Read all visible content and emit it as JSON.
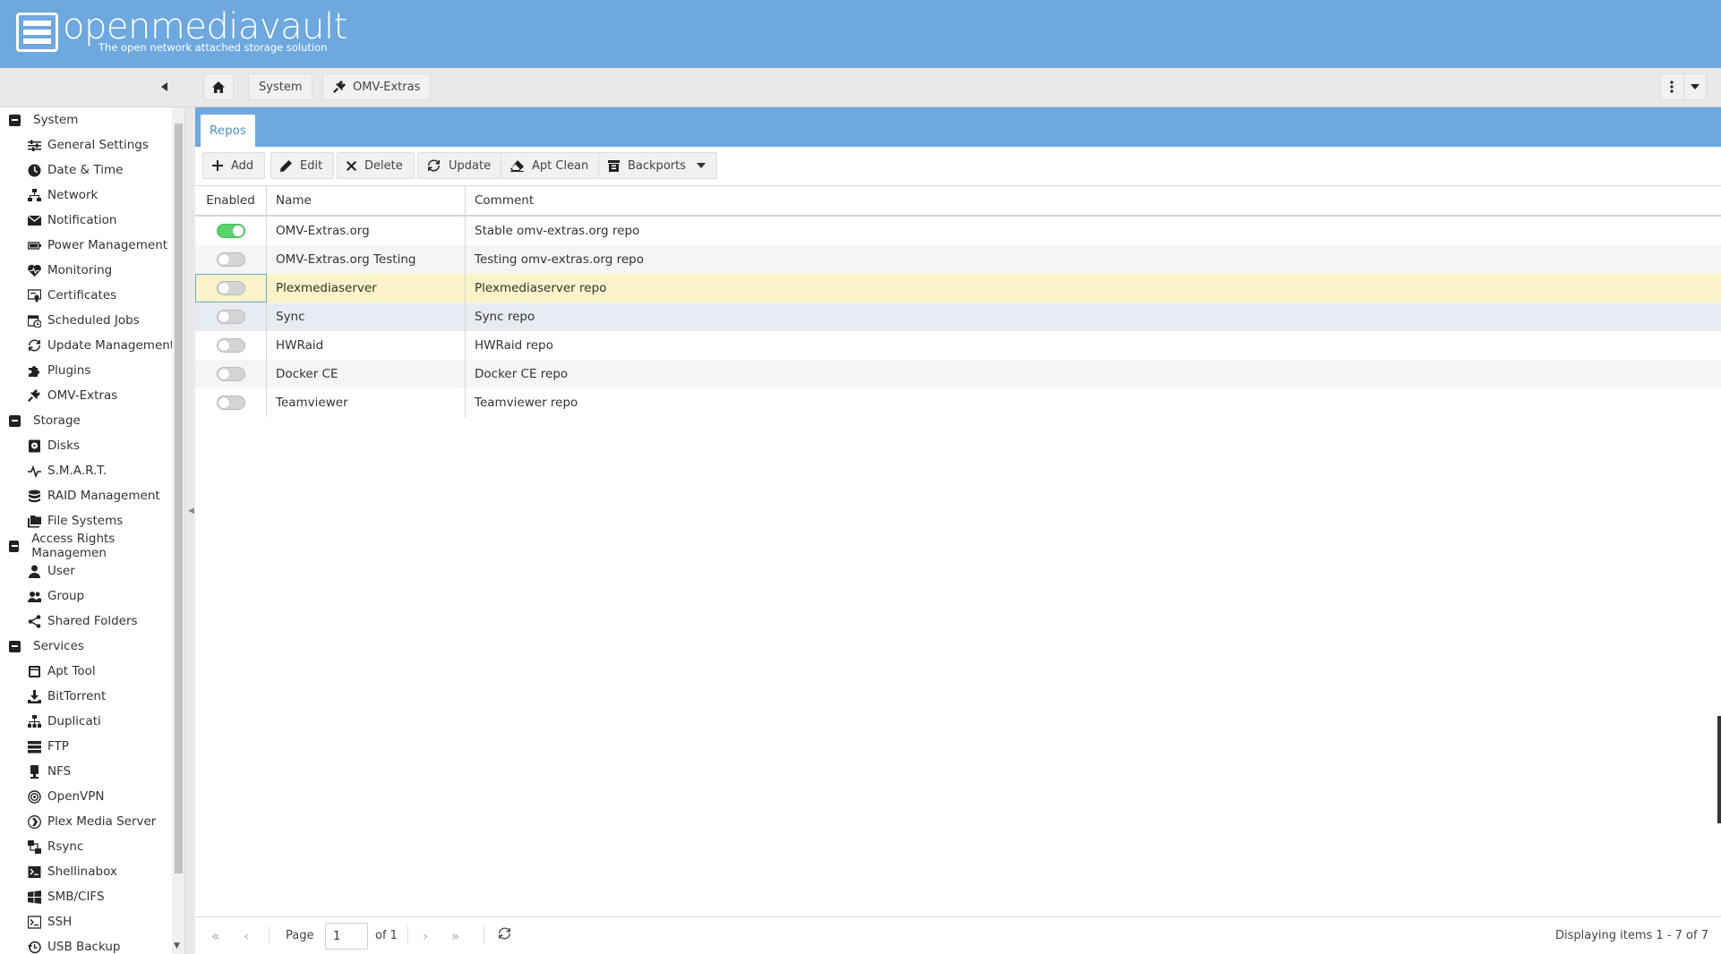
{
  "header": {
    "brand": "openmediavault",
    "tagline": "The open network attached storage solution"
  },
  "breadcrumbs": [
    {
      "label": "System"
    },
    {
      "label": "OMV-Extras"
    }
  ],
  "sidebar": {
    "groups": [
      {
        "label": "System",
        "items": [
          {
            "label": "General Settings",
            "icon": "sliders-icon"
          },
          {
            "label": "Date & Time",
            "icon": "clock-icon"
          },
          {
            "label": "Network",
            "icon": "network-icon"
          },
          {
            "label": "Notification",
            "icon": "mail-icon"
          },
          {
            "label": "Power Management",
            "icon": "battery-icon"
          },
          {
            "label": "Monitoring",
            "icon": "heartbeat-icon"
          },
          {
            "label": "Certificates",
            "icon": "certificate-icon"
          },
          {
            "label": "Scheduled Jobs",
            "icon": "calendar-clock-icon"
          },
          {
            "label": "Update Management",
            "icon": "refresh-icon"
          },
          {
            "label": "Plugins",
            "icon": "puzzle-icon"
          },
          {
            "label": "OMV-Extras",
            "icon": "plug-icon"
          }
        ]
      },
      {
        "label": "Storage",
        "items": [
          {
            "label": "Disks",
            "icon": "disk-icon"
          },
          {
            "label": "S.M.A.R.T.",
            "icon": "pulse-icon"
          },
          {
            "label": "RAID Management",
            "icon": "database-icon"
          },
          {
            "label": "File Systems",
            "icon": "folders-icon"
          }
        ]
      },
      {
        "label": "Access Rights Managemen",
        "items": [
          {
            "label": "User",
            "icon": "user-icon"
          },
          {
            "label": "Group",
            "icon": "group-icon"
          },
          {
            "label": "Shared Folders",
            "icon": "share-icon"
          }
        ]
      },
      {
        "label": "Services",
        "items": [
          {
            "label": "Apt Tool",
            "icon": "package-icon"
          },
          {
            "label": "BitTorrent",
            "icon": "download-icon"
          },
          {
            "label": "Duplicati",
            "icon": "sitemap-icon"
          },
          {
            "label": "FTP",
            "icon": "server-icon"
          },
          {
            "label": "NFS",
            "icon": "desktop-icon"
          },
          {
            "label": "OpenVPN",
            "icon": "wifi-icon"
          },
          {
            "label": "Plex Media Server",
            "icon": "plex-icon"
          },
          {
            "label": "Rsync",
            "icon": "sync-icon"
          },
          {
            "label": "Shellinabox",
            "icon": "terminal-icon"
          },
          {
            "label": "SMB/CIFS",
            "icon": "windows-icon"
          },
          {
            "label": "SSH",
            "icon": "console-icon"
          },
          {
            "label": "USB Backup",
            "icon": "history-icon"
          }
        ]
      }
    ]
  },
  "tabs": [
    {
      "label": "Repos"
    }
  ],
  "actions": [
    {
      "label": "Add",
      "icon": "plus-icon"
    },
    {
      "label": "Edit",
      "icon": "pencil-icon"
    },
    {
      "label": "Delete",
      "icon": "x-icon"
    },
    {
      "label": "Update",
      "icon": "refresh-icon"
    },
    {
      "label": "Apt Clean",
      "icon": "eraser-icon"
    },
    {
      "label": "Backports",
      "icon": "archive-icon"
    }
  ],
  "grid": {
    "columns": [
      "Enabled",
      "Name",
      "Comment"
    ],
    "rows": [
      {
        "enabled": true,
        "name": "OMV-Extras.org",
        "comment": "Stable omv-extras.org repo"
      },
      {
        "enabled": false,
        "name": "OMV-Extras.org Testing",
        "comment": "Testing omv-extras.org repo"
      },
      {
        "enabled": false,
        "name": "Plexmediaserver",
        "comment": "Plexmediaserver repo"
      },
      {
        "enabled": false,
        "name": "Sync",
        "comment": "Sync repo"
      },
      {
        "enabled": false,
        "name": "HWRaid",
        "comment": "HWRaid repo"
      },
      {
        "enabled": false,
        "name": "Docker CE",
        "comment": "Docker CE repo"
      },
      {
        "enabled": false,
        "name": "Teamviewer",
        "comment": "Teamviewer repo"
      }
    ]
  },
  "pager": {
    "page_label": "Page",
    "page_value": "1",
    "of_label": "of 1",
    "status": "Displaying items 1 - 7 of 7"
  },
  "colors": {
    "header_bg": "#6ea8de",
    "toggle_on": "#58d26a",
    "selected_row": "#faf3c8"
  }
}
